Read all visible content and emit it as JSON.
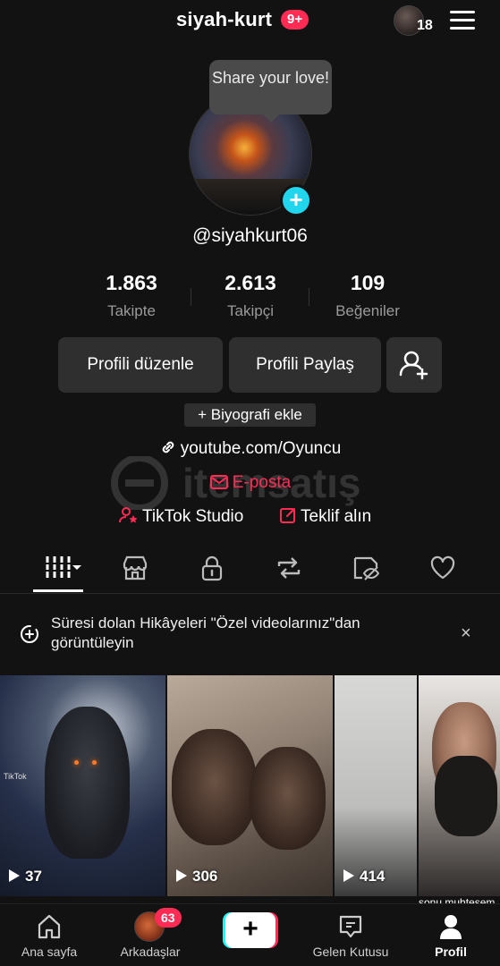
{
  "header": {
    "title": "siyah-kurt",
    "notification_badge": "9+",
    "viewer_count": "18",
    "menu_icon": "hamburger-menu-icon"
  },
  "profile": {
    "tooltip": "Share your love!",
    "handle": "@siyahkurt06",
    "add_icon": "plus-icon",
    "accent_color": "#20d5ec"
  },
  "stats": [
    {
      "value": "1.863",
      "label": "Takipte"
    },
    {
      "value": "2.613",
      "label": "Takipçi"
    },
    {
      "value": "109",
      "label": "Beğeniler"
    }
  ],
  "actions": {
    "edit_profile": "Profili düzenle",
    "share_profile": "Profili Paylaş",
    "add_bio": "+ Biyografi ekle"
  },
  "links": {
    "website": "youtube.com/Oyuncu",
    "email": "E-posta",
    "studio": "TikTok Studio",
    "offer": "Teklif alın"
  },
  "tabs": [
    {
      "icon": "grid-icon",
      "active": true
    },
    {
      "icon": "shop-icon"
    },
    {
      "icon": "lock-icon"
    },
    {
      "icon": "repost-icon"
    },
    {
      "icon": "hidden-eye-icon"
    },
    {
      "icon": "heart-icon"
    }
  ],
  "notice": {
    "text": "Süresi dolan Hikâyeleri \"Özel videolarınız\"dan görüntüleyin",
    "close": "×"
  },
  "videos": [
    {
      "views": "37",
      "tag": "TikTok"
    },
    {
      "views": "306"
    },
    {
      "views": "414"
    },
    {
      "views": "",
      "caption": "sonu muhteşem ‼️😂"
    }
  ],
  "bottom_nav": [
    {
      "label": "Ana sayfa",
      "icon": "home-icon"
    },
    {
      "label": "Arkadaşlar",
      "badge": "63"
    },
    {
      "label": "+",
      "icon": "create-icon"
    },
    {
      "label": "Gelen Kutusu",
      "icon": "inbox-icon"
    },
    {
      "label": "Profil",
      "icon": "profile-icon",
      "active": true
    }
  ],
  "colors": {
    "background": "#121212",
    "brand_red": "#fe2c55",
    "brand_cyan": "#25f4ee"
  }
}
